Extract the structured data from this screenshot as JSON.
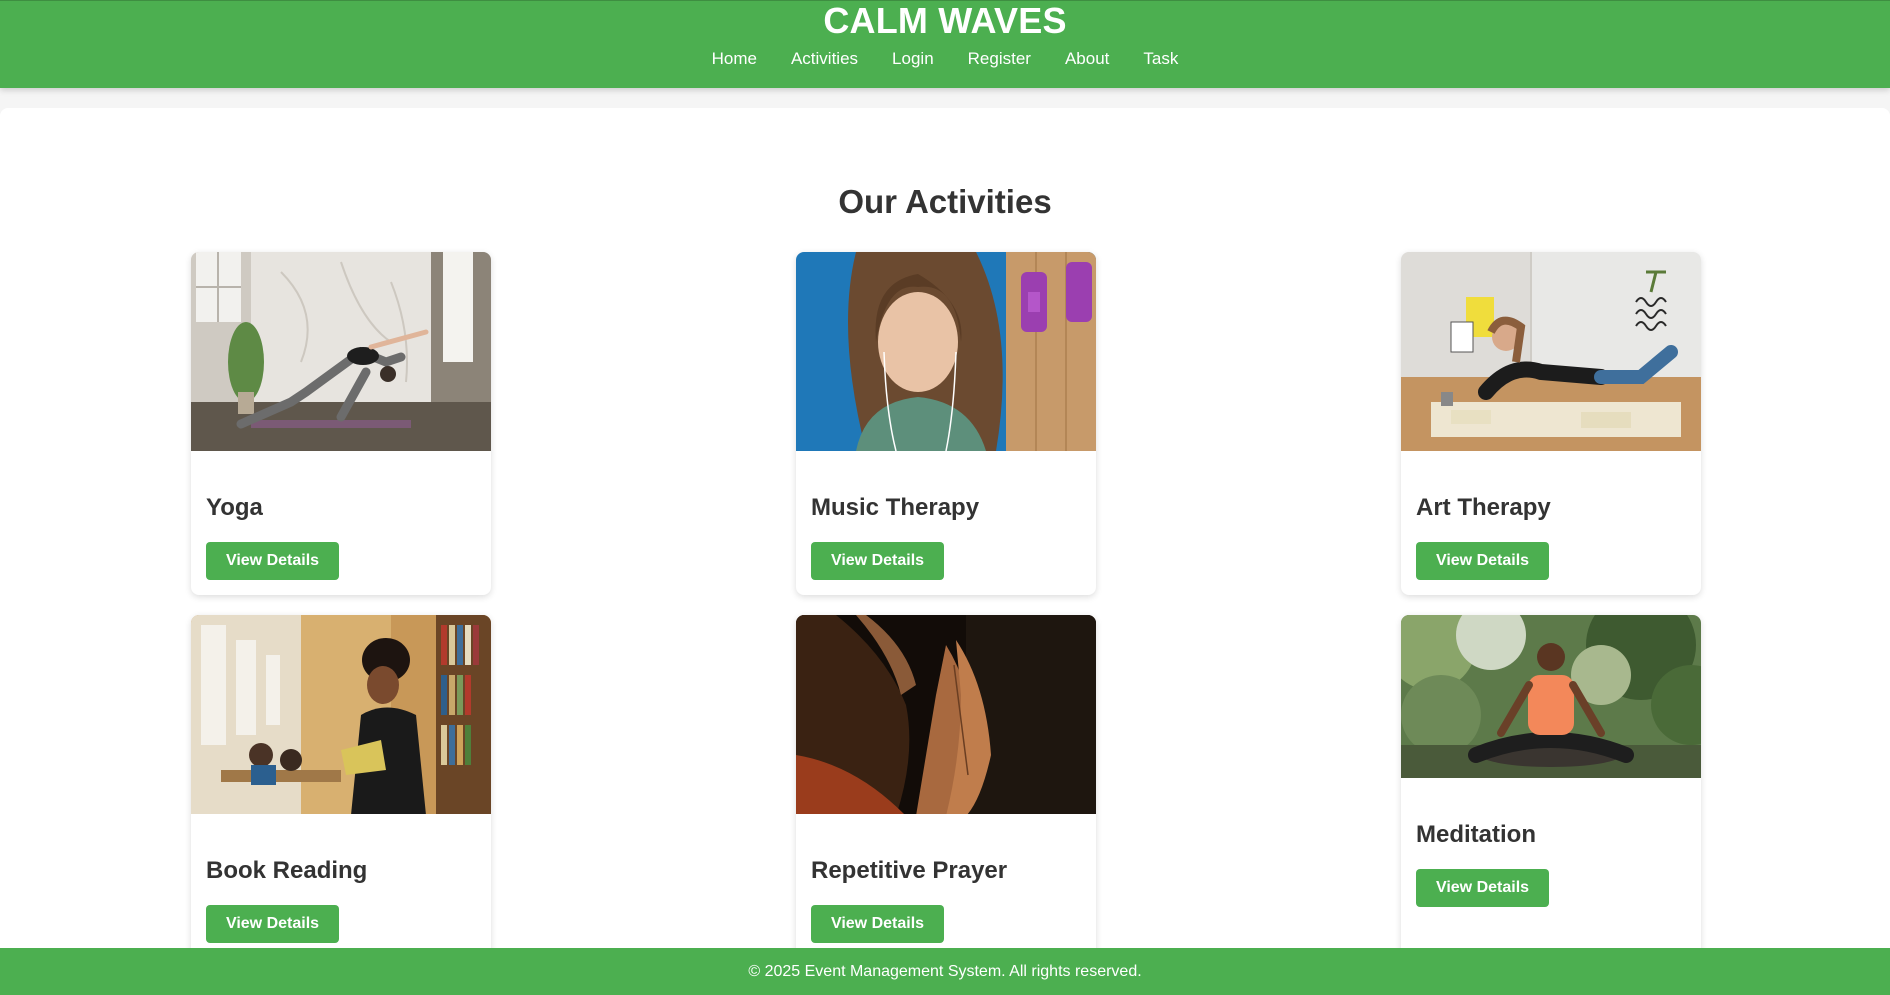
{
  "header": {
    "brand": "CALM WAVES",
    "nav": [
      "Home",
      "Activities",
      "Login",
      "Register",
      "About",
      "Task"
    ]
  },
  "main": {
    "title": "Our Activities",
    "cards": [
      {
        "title": "Yoga",
        "button": "View Details"
      },
      {
        "title": "Music Therapy",
        "button": "View Details"
      },
      {
        "title": "Art Therapy",
        "button": "View Details"
      },
      {
        "title": "Book Reading",
        "button": "View Details"
      },
      {
        "title": "Repetitive Prayer",
        "button": "View Details"
      },
      {
        "title": "Meditation",
        "button": "View Details"
      }
    ]
  },
  "footer": {
    "text": "© 2025 Event Management System. All rights reserved."
  },
  "colors": {
    "brand_green": "#4caf50",
    "text_dark": "#333333",
    "page_bg": "#f5f5f5"
  }
}
